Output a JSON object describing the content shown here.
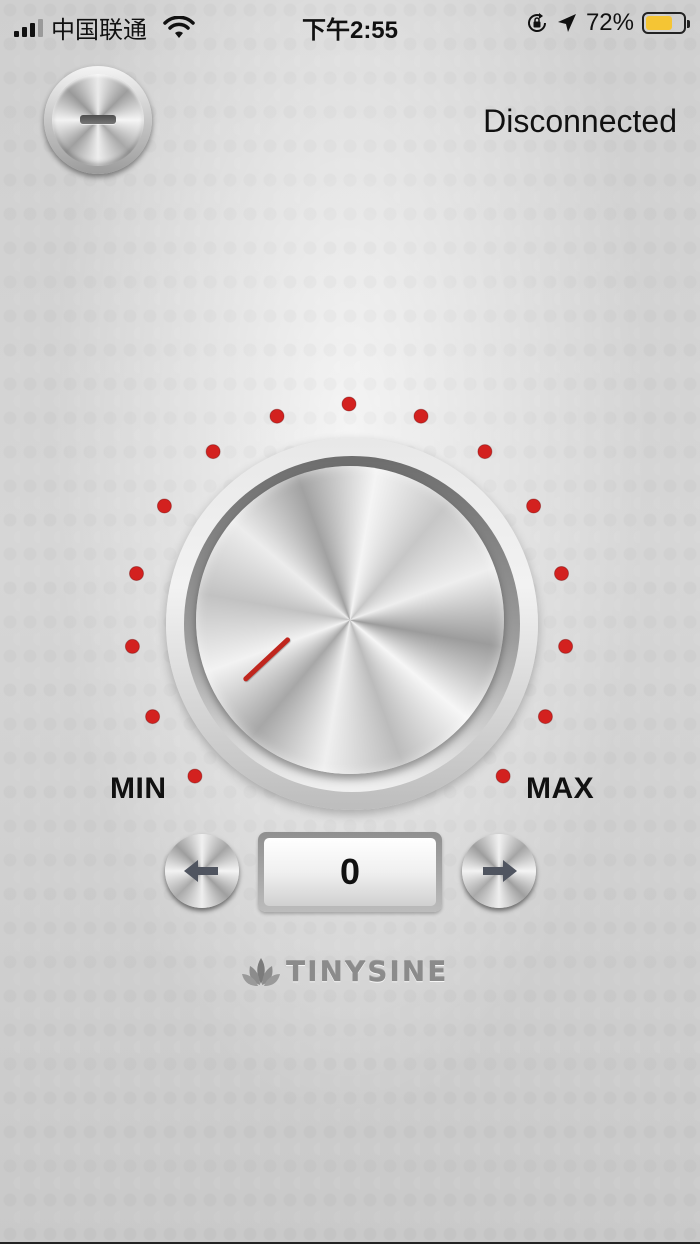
{
  "status_bar": {
    "carrier": "中国联通",
    "time": "下午2:55",
    "battery_percent": "72%",
    "battery_level": 0.72,
    "icons": [
      "signal-icon",
      "wifi-icon",
      "rotation-lock-icon",
      "location-arrow-icon",
      "battery-icon"
    ]
  },
  "header": {
    "menu_icon": "minus-icon",
    "connection_status": "Disconnected"
  },
  "dial": {
    "min_label": "MIN",
    "max_label": "MAX",
    "value": "0",
    "indicator_color": "#c0261e",
    "tick_color": "#d3211f",
    "tick_count": 15
  },
  "controls": {
    "decrement_icon": "arrow-left-icon",
    "increment_icon": "arrow-right-icon"
  },
  "brand": {
    "logo_icon": "lotus-icon",
    "name": "TINYSINE"
  }
}
